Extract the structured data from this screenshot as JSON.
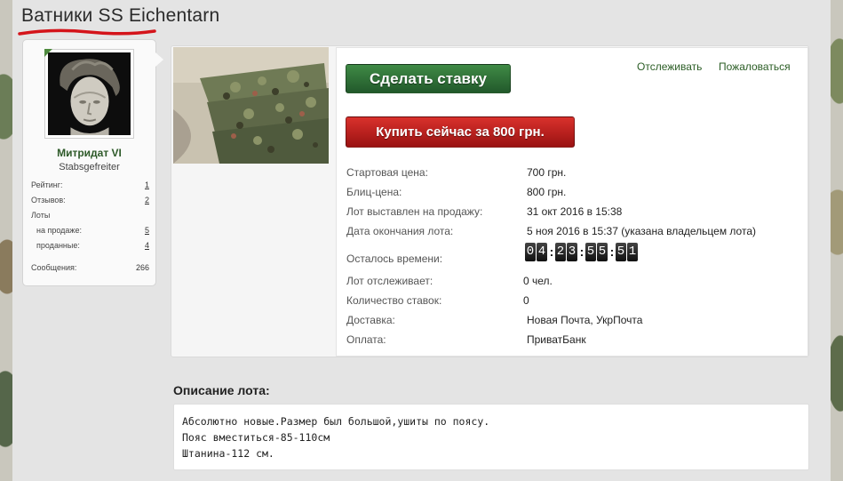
{
  "thread": {
    "title": "Ватники SS Eichentarn"
  },
  "user": {
    "name": "Митридат VI",
    "rank": "Stabsgefreiter",
    "stats": [
      {
        "label": "Рейтинг:",
        "value": "1"
      },
      {
        "label": "Отзывов:",
        "value": "2"
      },
      {
        "label": "Лоты",
        "value": ""
      },
      {
        "label": "на продаже:",
        "value": "5"
      },
      {
        "label": "проданные:",
        "value": "4"
      },
      {
        "label": "Сообщения:",
        "value": "266"
      }
    ]
  },
  "actions": {
    "bid_label": "Сделать ставку",
    "buy_label": "Купить сейчас за 800 грн.",
    "follow_label": "Отслеживать",
    "report_label": "Пожаловаться"
  },
  "lot": {
    "fields": [
      {
        "label": "Стартовая цена:",
        "value": "700 грн."
      },
      {
        "label": "Блиц-цена:",
        "value": "800 грн."
      },
      {
        "label": "Лот выставлен на продажу:",
        "value": "31 окт 2016 в 15:38"
      },
      {
        "label": "Дата окончания лота:",
        "value": "5 ноя 2016 в 15:37 (указана владельцем лота)"
      },
      {
        "label": "Осталось времени:",
        "value": ""
      },
      {
        "label": "Лот отслеживает:",
        "value": "0 чел."
      },
      {
        "label": "Количество ставок:",
        "value": "0"
      },
      {
        "label": "Доставка:",
        "value": "Новая Почта, УкрПочта"
      },
      {
        "label": "Оплата:",
        "value": "ПриватБанк"
      }
    ],
    "timer_digits": [
      "0",
      "4",
      "2",
      "3",
      "5",
      "5",
      "5",
      "1"
    ],
    "timer_sep": ":"
  },
  "description": {
    "title": "Описание лота:",
    "lines": [
      "Абсолютно новые.Размер был большой,ушиты по поясу.",
      "Пояс вместиться-85-110см",
      "Штанина-112 см."
    ]
  }
}
